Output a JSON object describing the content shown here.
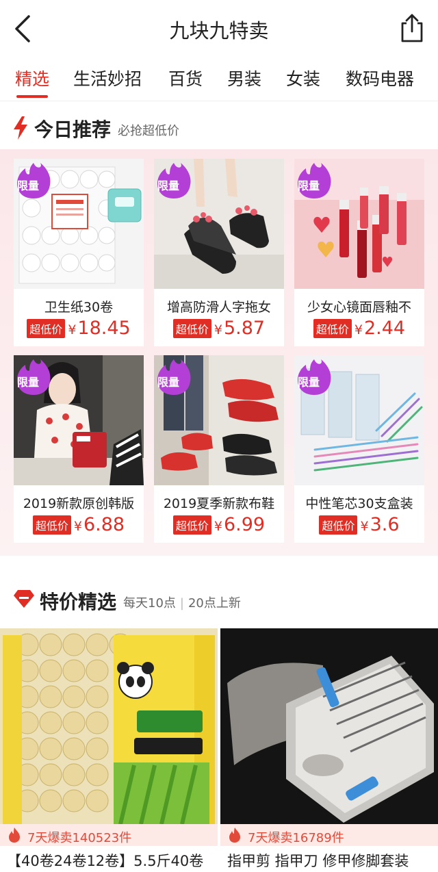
{
  "header": {
    "title": "九块九特卖",
    "back_icon": "back-arrow-icon",
    "share_icon": "share-icon"
  },
  "tabs": [
    {
      "label": "精选",
      "active": true
    },
    {
      "label": "生活妙招"
    },
    {
      "label": "百货"
    },
    {
      "label": "男装"
    },
    {
      "label": "女装"
    },
    {
      "label": "数码电器"
    }
  ],
  "today": {
    "title": "今日推荐",
    "subtitle": "必抢超低价",
    "icon": "lightning-icon",
    "badge_label": "限量",
    "price_tag": "超低价",
    "currency": "¥",
    "products": [
      {
        "name": "卫生纸30卷",
        "price": "18.45",
        "limited": true
      },
      {
        "name": "增高防滑人字拖女",
        "price": "5.87",
        "limited": true
      },
      {
        "name": "少女心镜面唇釉不",
        "price": "2.44",
        "limited": true
      },
      {
        "name": "2019新款原创韩版",
        "price": "6.88",
        "limited": true
      },
      {
        "name": "2019夏季新款布鞋",
        "price": "6.99",
        "limited": true
      },
      {
        "name": "中性笔芯30支盒装",
        "price": "3.6",
        "limited": true
      }
    ]
  },
  "special": {
    "title": "特价精选",
    "sub_a": "每天10点",
    "sub_sep": "|",
    "sub_b": "20点上新",
    "icon": "diamond-icon",
    "items": [
      {
        "sold": "7天爆卖140523件",
        "name": "【40卷24卷12卷】5.5斤40卷"
      },
      {
        "sold": "7天爆卖16789件",
        "name": "指甲剪 指甲刀 修甲修脚套装"
      }
    ]
  },
  "colors": {
    "accent": "#e02e24",
    "badge": "#b33fd6",
    "pink_bg": "#fbe7e9"
  }
}
